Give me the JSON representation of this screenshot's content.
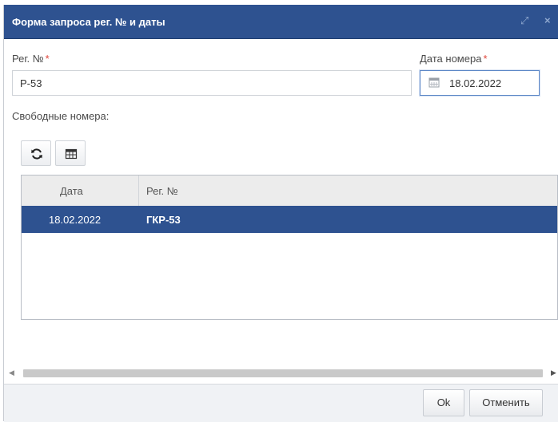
{
  "window": {
    "title": "Форма запроса рег. № и даты",
    "maximize_icon": "⤢",
    "close_icon": "×"
  },
  "form": {
    "reg_no_label": "Рег. №",
    "reg_no_required": "*",
    "reg_no_value": "Р-53",
    "date_label": "Дата номера",
    "date_required": "*",
    "date_value": "18.02.2022",
    "free_numbers_label": "Свободные номера:"
  },
  "toolbar": {
    "refresh_icon": "refresh-icon",
    "table_icon": "table-icon"
  },
  "grid": {
    "columns": [
      "Дата",
      "Рег. №"
    ],
    "rows": [
      {
        "date": "18.02.2022",
        "reg_no": "ГКР-53",
        "selected": true
      }
    ]
  },
  "footer": {
    "ok_label": "Ok",
    "cancel_label": "Отменить"
  },
  "colors": {
    "titlebar": "#2e5290",
    "selected_row": "#2e5290",
    "required_marker": "#e0453a"
  }
}
